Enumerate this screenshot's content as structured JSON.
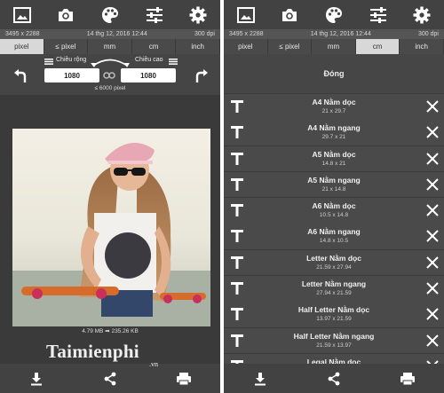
{
  "info": {
    "resolution": "3495 x 2288",
    "date": "14 thg 12, 2016 12:44",
    "dpi": "300 dpi"
  },
  "units": {
    "left": [
      {
        "label": "pixel",
        "selected": true
      },
      {
        "label": "≤ pixel",
        "selected": false
      },
      {
        "label": "mm",
        "selected": false
      },
      {
        "label": "cm",
        "selected": false
      },
      {
        "label": "inch",
        "selected": false
      }
    ],
    "right": [
      {
        "label": "pixel",
        "selected": false
      },
      {
        "label": "≤ pixel",
        "selected": false
      },
      {
        "label": "mm",
        "selected": false
      },
      {
        "label": "cm",
        "selected": true
      },
      {
        "label": "inch",
        "selected": false
      }
    ]
  },
  "resize": {
    "width_label": "Chiều rộng",
    "height_label": "Chiều cao",
    "width_value": "1080",
    "height_value": "1080",
    "max_pixel": "≤ 6000 pixel"
  },
  "image": {
    "size_info": "4.79 MB ➡ 235.26 KB"
  },
  "watermark": {
    "brand": "Taimienphi",
    "suffix": ".vn"
  },
  "presets": {
    "close_label": "Đóng",
    "items": [
      {
        "label": "A4 Nằm dọc",
        "dim": "21 x 29.7"
      },
      {
        "label": "A4 Nằm ngang",
        "dim": "29.7 x 21"
      },
      {
        "label": "A5 Nằm dọc",
        "dim": "14.8 x 21"
      },
      {
        "label": "A5 Nằm ngang",
        "dim": "21 x 14.8"
      },
      {
        "label": "A6 Nằm dọc",
        "dim": "10.5 x 14.8"
      },
      {
        "label": "A6 Nằm ngang",
        "dim": "14.8 x 10.5"
      },
      {
        "label": "Letter Nằm dọc",
        "dim": "21.59 x 27.94"
      },
      {
        "label": "Letter Nằm ngang",
        "dim": "27.94 x 21.59"
      },
      {
        "label": "Half Letter Nằm dọc",
        "dim": "13.97 x 21.59"
      },
      {
        "label": "Half Letter Nằm ngang",
        "dim": "21.59 x 13.97"
      },
      {
        "label": "Legal Nằm dọc",
        "dim": ""
      }
    ]
  },
  "icons": {
    "toolbar": [
      "image-icon",
      "camera-icon",
      "palette-icon",
      "sliders-icon",
      "gear-icon"
    ],
    "bottom": [
      "download-icon",
      "share-icon",
      "print-icon"
    ]
  }
}
